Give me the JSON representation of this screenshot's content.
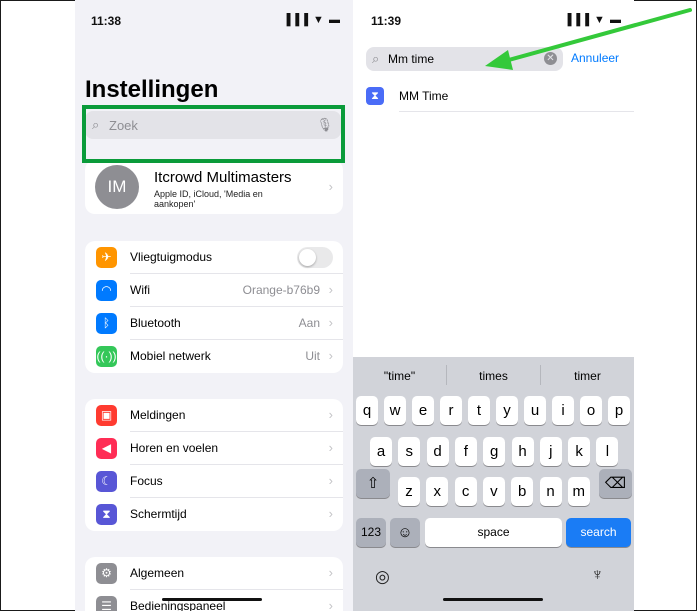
{
  "left": {
    "status_time": "11:38",
    "status_icons": "▐▐▐ ▼ ▬",
    "title": "Instellingen",
    "search_placeholder": "Zoek",
    "profile": {
      "initials": "IM",
      "name": "Itcrowd Multimasters",
      "subtitle": "Apple ID, iCloud, 'Media en aankopen'"
    },
    "group1": [
      {
        "label": "Vliegtuigmodus",
        "value": "",
        "icon": "airplane-icon",
        "glyph": "✈",
        "color": "#ff9500"
      },
      {
        "label": "Wifi",
        "value": "Orange-b76b9",
        "icon": "wifi-icon",
        "glyph": "◠",
        "color": "#007aff"
      },
      {
        "label": "Bluetooth",
        "value": "Aan",
        "icon": "bluetooth-icon",
        "glyph": "ᛒ",
        "color": "#007aff"
      },
      {
        "label": "Mobiel netwerk",
        "value": "Uit",
        "icon": "cellular-icon",
        "glyph": "((·))",
        "color": "#34c759"
      }
    ],
    "group2": [
      {
        "label": "Meldingen",
        "icon": "notifications-icon",
        "glyph": "▣",
        "color": "#ff3b30"
      },
      {
        "label": "Horen en voelen",
        "icon": "sound-icon",
        "glyph": "◀",
        "color": "#ff2d55"
      },
      {
        "label": "Focus",
        "icon": "focus-moon-icon",
        "glyph": "☾",
        "color": "#5856d6"
      },
      {
        "label": "Schermtijd",
        "icon": "screentime-hourglass-icon",
        "glyph": "⧗",
        "color": "#5856d6"
      }
    ],
    "group3": [
      {
        "label": "Algemeen",
        "icon": "general-gear-icon",
        "glyph": "⚙",
        "color": "#8e8e93"
      },
      {
        "label": "Bedieningspaneel",
        "icon": "control-center-icon",
        "glyph": "☰",
        "color": "#8e8e93"
      }
    ],
    "chevron": "›"
  },
  "right": {
    "status_time": "11:39",
    "status_icons": "▐▐▐ ▼ ▬",
    "search_value": "Mm time",
    "cancel_label": "Annuleer",
    "result_label": "MM Time",
    "result_glyph": "⧗",
    "suggestions": [
      "\"time\"",
      "times",
      "timer"
    ],
    "row1": [
      "q",
      "w",
      "e",
      "r",
      "t",
      "y",
      "u",
      "i",
      "o",
      "p"
    ],
    "row2": [
      "a",
      "s",
      "d",
      "f",
      "g",
      "h",
      "j",
      "k",
      "l"
    ],
    "row3": [
      "z",
      "x",
      "c",
      "v",
      "b",
      "n",
      "m"
    ],
    "shift_glyph": "⇧",
    "delete_glyph": "⌫",
    "numbers_label": "123",
    "emoji_glyph": "☺",
    "space_label": "space",
    "search_label": "search",
    "globe_glyph": "◎",
    "mic_glyph": "♆"
  },
  "colors": {
    "highlight": "#0a9b3a",
    "arrow": "#34c93a",
    "accent": "#007aff"
  }
}
